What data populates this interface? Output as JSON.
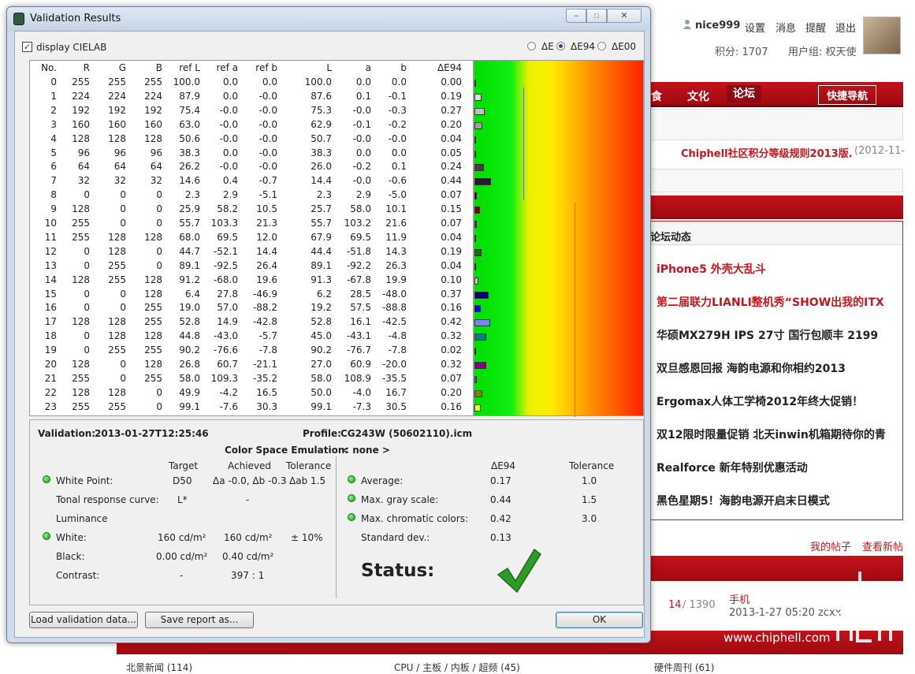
{
  "forum": {
    "username": "nice999",
    "links": [
      "设置",
      "消息",
      "提醒",
      "退出"
    ],
    "points": "积分: 1707",
    "usergroup": "用户组: 权天使",
    "nav": {
      "food": "食",
      "culture": "文化",
      "forum": "论坛",
      "quicknav": "快捷导航"
    },
    "notice": "Chiphell社区积分等级规则2013版.",
    "notice_date": "(2012-11-",
    "section_title": "论坛动态",
    "feed": [
      "iPhone5 外壳大乱斗",
      "第二届联力LIANLI整机秀“SHOW出我的ITX",
      "华硕MX279H IPS 27寸 国行包顺丰 2199",
      "双旦感恩回报 海韵电源和你相约2013",
      "Ergomax人体工学椅2012年终大促销！",
      "双12限时限量促销 北天inwin机箱期待你的青",
      "Realforce 新年特别优惠活动",
      "黑色星期5！海韵电源开启末日模式"
    ],
    "my_posts": "我的帖子",
    "new_posts": "查看新帖",
    "thread_count": "14",
    "thread_total": "/ 1390",
    "thread_cat": "手机",
    "thread_meta": "2013-1-27 05:20 zcxx",
    "watermark": "www.chiphell.com",
    "bottom_links": [
      "北景新闻 (114)",
      "CPU / 主板 / 内板 / 超频 (45)",
      "硬件周刊 (61)"
    ]
  },
  "dialog": {
    "title": "Validation Results",
    "display_cielab": "display CIELAB",
    "radio": [
      "ΔE",
      "ΔE94",
      "ΔE00"
    ],
    "selected_radio": 1,
    "columns": [
      "No.",
      "R",
      "G",
      "B",
      "ref L",
      "ref a",
      "ref b",
      "L",
      "a",
      "b",
      "ΔE94"
    ],
    "rows": [
      [
        "0",
        "255",
        "255",
        "255",
        "100.0",
        "0.0",
        "0.0",
        "100.0",
        "0.0",
        "0.0",
        "0.00"
      ],
      [
        "1",
        "224",
        "224",
        "224",
        "87.9",
        "0.0",
        "-0.0",
        "87.6",
        "0.1",
        "-0.1",
        "0.19"
      ],
      [
        "2",
        "192",
        "192",
        "192",
        "75.4",
        "-0.0",
        "-0.0",
        "75.3",
        "-0.0",
        "-0.3",
        "0.27"
      ],
      [
        "3",
        "160",
        "160",
        "160",
        "63.0",
        "-0.0",
        "-0.0",
        "62.9",
        "-0.1",
        "-0.2",
        "0.20"
      ],
      [
        "4",
        "128",
        "128",
        "128",
        "50.6",
        "-0.0",
        "-0.0",
        "50.7",
        "-0.0",
        "-0.0",
        "0.04"
      ],
      [
        "5",
        "96",
        "96",
        "96",
        "38.3",
        "0.0",
        "-0.0",
        "38.3",
        "0.0",
        "0.0",
        "0.05"
      ],
      [
        "6",
        "64",
        "64",
        "64",
        "26.2",
        "-0.0",
        "-0.0",
        "26.0",
        "-0.2",
        "0.1",
        "0.24"
      ],
      [
        "7",
        "32",
        "32",
        "32",
        "14.6",
        "0.4",
        "-0.7",
        "14.4",
        "-0.0",
        "-0.6",
        "0.44"
      ],
      [
        "8",
        "0",
        "0",
        "0",
        "2.3",
        "2.9",
        "-5.1",
        "2.3",
        "2.9",
        "-5.0",
        "0.07"
      ],
      [
        "9",
        "128",
        "0",
        "0",
        "25.9",
        "58.2",
        "10.5",
        "25.7",
        "58.0",
        "10.1",
        "0.15"
      ],
      [
        "10",
        "255",
        "0",
        "0",
        "55.7",
        "103.3",
        "21.3",
        "55.7",
        "103.2",
        "21.6",
        "0.07"
      ],
      [
        "11",
        "255",
        "128",
        "128",
        "68.0",
        "69.5",
        "12.0",
        "67.9",
        "69.5",
        "11.9",
        "0.04"
      ],
      [
        "12",
        "0",
        "128",
        "0",
        "44.7",
        "-52.1",
        "14.4",
        "44.4",
        "-51.8",
        "14.3",
        "0.19"
      ],
      [
        "13",
        "0",
        "255",
        "0",
        "89.1",
        "-92.5",
        "26.4",
        "89.1",
        "-92.2",
        "26.3",
        "0.04"
      ],
      [
        "14",
        "128",
        "255",
        "128",
        "91.2",
        "-68.0",
        "19.6",
        "91.3",
        "-67.8",
        "19.9",
        "0.10"
      ],
      [
        "15",
        "0",
        "0",
        "128",
        "6.4",
        "27.8",
        "-46.9",
        "6.2",
        "28.5",
        "-48.0",
        "0.37"
      ],
      [
        "16",
        "0",
        "0",
        "255",
        "19.0",
        "57.0",
        "-88.2",
        "19.2",
        "57.5",
        "-88.8",
        "0.16"
      ],
      [
        "17",
        "128",
        "128",
        "255",
        "52.8",
        "14.9",
        "-42.8",
        "52.8",
        "16.1",
        "-42.5",
        "0.42"
      ],
      [
        "18",
        "0",
        "128",
        "128",
        "44.8",
        "-43.0",
        "-5.7",
        "45.0",
        "-43.1",
        "-4.8",
        "0.32"
      ],
      [
        "19",
        "0",
        "255",
        "255",
        "90.2",
        "-76.6",
        "-7.8",
        "90.2",
        "-76.7",
        "-7.8",
        "0.02"
      ],
      [
        "20",
        "128",
        "0",
        "128",
        "26.8",
        "60.7",
        "-21.1",
        "27.0",
        "60.9",
        "-20.0",
        "0.32"
      ],
      [
        "21",
        "255",
        "0",
        "255",
        "58.0",
        "109.3",
        "-35.2",
        "58.0",
        "108.9",
        "-35.5",
        "0.07"
      ],
      [
        "22",
        "128",
        "128",
        "0",
        "49.9",
        "-4.2",
        "16.5",
        "50.0",
        "-4.0",
        "16.7",
        "0.20"
      ],
      [
        "23",
        "255",
        "255",
        "0",
        "99.1",
        "-7.6",
        "30.3",
        "99.1",
        "-7.3",
        "30.5",
        "0.16"
      ]
    ],
    "validation_label": "Validation:",
    "validation_date": "2013-01-27T12:25:46",
    "profile_label": "Profile:",
    "profile": "CG243W (50602110).icm",
    "emulation_label": "Color Space Emulation:",
    "emulation": "< none >",
    "left_headers": [
      "Target",
      "Achieved",
      "Tolerance"
    ],
    "white_point": {
      "label": "White Point:",
      "target": "D50",
      "achieved": "Δa -0.0, Δb -0.3",
      "tolerance": "Δab 1.5"
    },
    "trc": {
      "label": "Tonal response curve:",
      "target": "L*",
      "achieved": "-"
    },
    "luminance": "Luminance",
    "white": {
      "label": "White:",
      "target": "160 cd/m²",
      "achieved": "160 cd/m²",
      "tolerance": "± 10%"
    },
    "black": {
      "label": "Black:",
      "target": "0.00 cd/m²",
      "achieved": "0.40 cd/m²"
    },
    "contrast": {
      "label": "Contrast:",
      "target": "-",
      "achieved": "397 : 1"
    },
    "right_headers": [
      "ΔE94",
      "Tolerance"
    ],
    "average": {
      "label": "Average:",
      "value": "0.17",
      "tolerance": "1.0"
    },
    "max_gray": {
      "label": "Max. gray scale:",
      "value": "0.44",
      "tolerance": "1.5"
    },
    "max_chroma": {
      "label": "Max. chromatic colors:",
      "value": "0.42",
      "tolerance": "3.0"
    },
    "std_dev": {
      "label": "Standard dev.:",
      "value": "0.13"
    },
    "status": "Status:",
    "load_button": "Load validation data...",
    "save_button": "Save report as...",
    "ok_button": "OK"
  }
}
